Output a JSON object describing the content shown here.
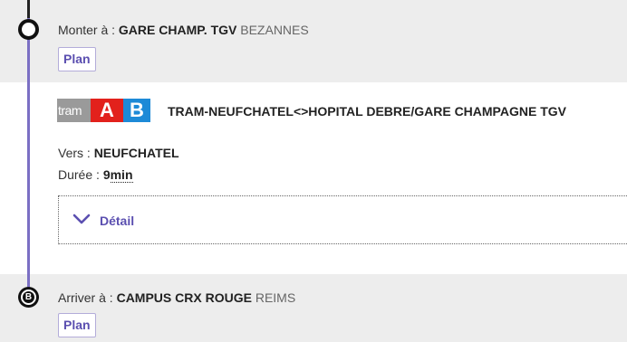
{
  "departure": {
    "prefix": "Monter à : ",
    "stop_name": "GARE CHAMP. TGV",
    "city": "BEZANNES",
    "plan_label": "Plan"
  },
  "section": {
    "badge": {
      "mode": "tram",
      "line_a": "A",
      "line_b": "B"
    },
    "route_name": "TRAM-NEUFCHATEL<>HOPITAL DEBRE/GARE CHAMPAGNE TGV",
    "direction_prefix": "Vers : ",
    "direction": "NEUFCHATEL",
    "duration_prefix": "Durée : ",
    "duration_value": "9",
    "duration_unit": "min",
    "detail_label": "Détail"
  },
  "arrival": {
    "marker": "B",
    "prefix": "Arriver à : ",
    "stop_name": "CAMPUS CRX ROUGE",
    "city": "REIMS",
    "plan_label": "Plan"
  },
  "colors": {
    "accent": "#5b4fb0",
    "timeline": "#7b6fc4",
    "line_a": "#e2211c",
    "line_b": "#1d8ad7",
    "tram_badge": "#9a9a9a",
    "stop_background": "#ededed"
  },
  "icons": {
    "start_marker": "circle-marker-icon",
    "end_marker": "b-marker-icon",
    "expand": "chevron-down-icon"
  }
}
